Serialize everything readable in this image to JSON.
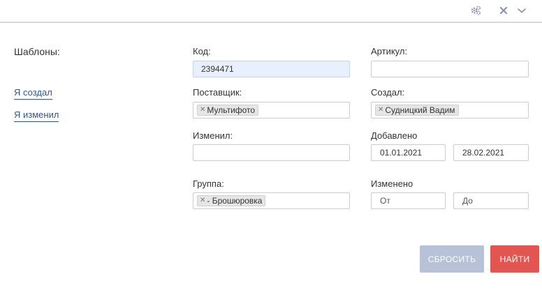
{
  "toolbar": {
    "icons": [
      "gears-icon",
      "close-icon",
      "chevron-down-icon"
    ]
  },
  "sidebar": {
    "title": "Шаблоны:",
    "links": [
      "Я создал",
      "Я изменил"
    ]
  },
  "form": {
    "code": {
      "label": "Код:",
      "value": "2394471"
    },
    "article": {
      "label": "Артикул:",
      "value": ""
    },
    "supplier": {
      "label": "Поставщик:",
      "tags": [
        "Мультифото"
      ]
    },
    "creator": {
      "label": "Создал:",
      "tags": [
        "Судницкий Вадим"
      ]
    },
    "modifier": {
      "label": "Изменил:",
      "value": ""
    },
    "added": {
      "label": "Добавлено",
      "from": "01.01.2021",
      "to": "28.02.2021"
    },
    "group": {
      "label": "Группа:",
      "tags": [
        "- Брошюровка"
      ]
    },
    "changed": {
      "label": "Изменено",
      "from_placeholder": "От",
      "to_placeholder": "До"
    }
  },
  "buttons": {
    "reset": "СБРОСИТЬ",
    "find": "НАЙТИ"
  },
  "colors": {
    "link": "#2f5596",
    "active_field_bg": "#e8f0fe",
    "reset_button": "#b7c2d8",
    "find_button": "#e25550"
  }
}
